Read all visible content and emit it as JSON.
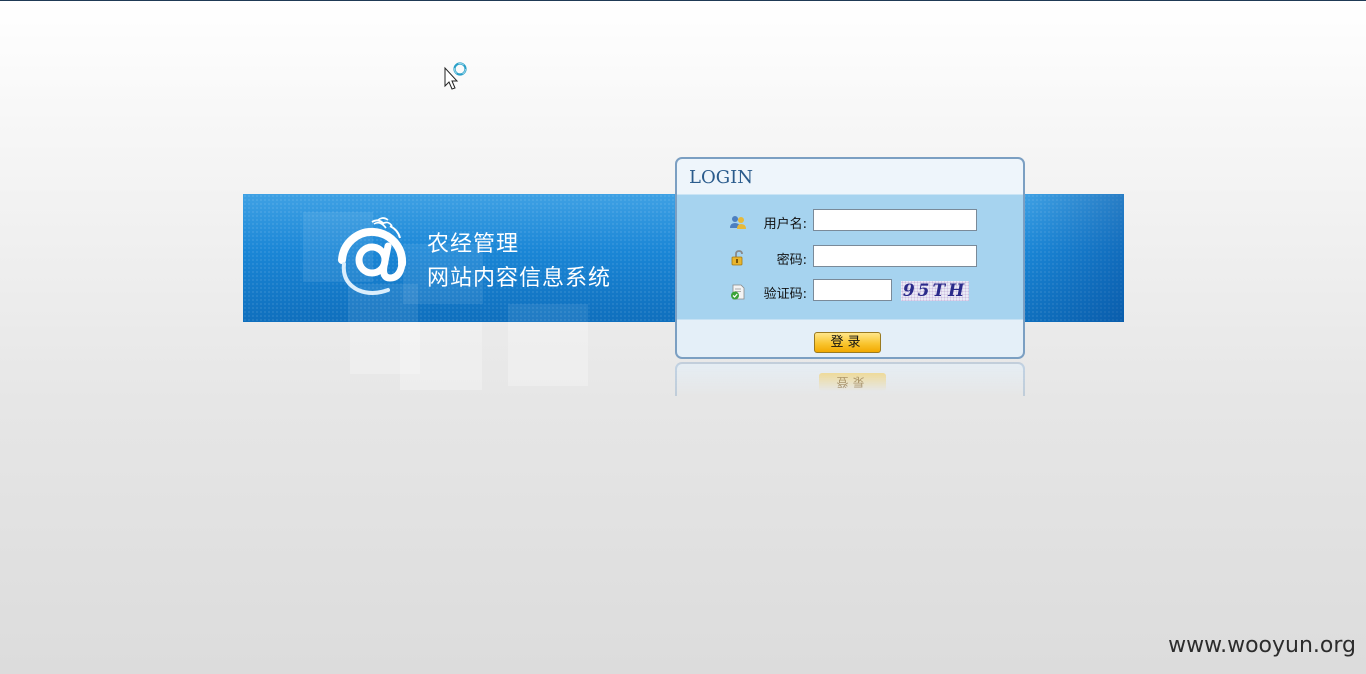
{
  "banner": {
    "title_line1": "农经管理",
    "title_line2": "网站内容信息系统",
    "logo_icon": "at-wheat-logo-icon",
    "color_top": "#3fa1e4",
    "color_bottom": "#0f6fbd"
  },
  "login": {
    "heading": "LOGIN",
    "username_label": "用户名:",
    "username_value": "",
    "username_icon": "users-icon",
    "password_label": "密码:",
    "password_value": "",
    "password_icon": "lock-icon",
    "captcha_label": "验证码:",
    "captcha_value": "",
    "captcha_icon": "verify-document-icon",
    "captcha_image_text": "95TH",
    "submit_label": "登录",
    "reflection_label": "登录",
    "button_color": "#f9c530",
    "panel_color": "#a6d3ef"
  },
  "watermark": {
    "text": "www.wooyun.org"
  }
}
